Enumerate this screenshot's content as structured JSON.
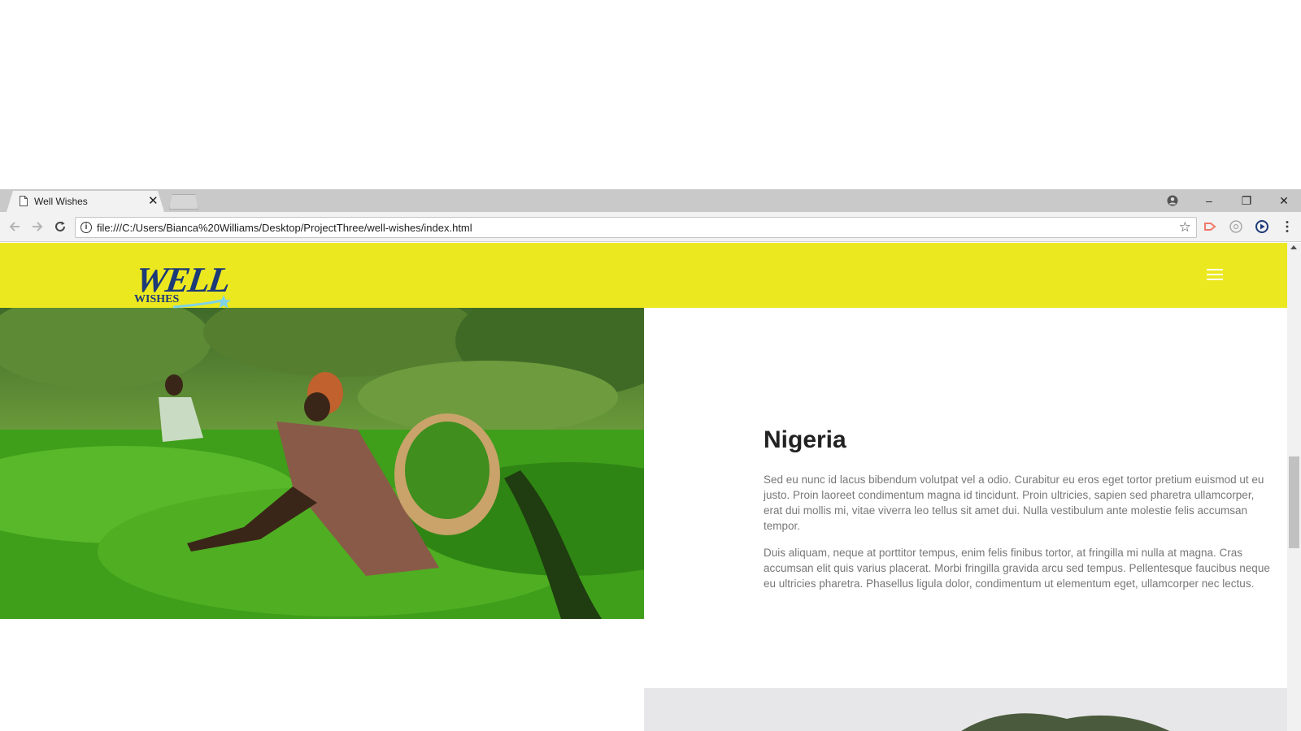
{
  "browser": {
    "tab_title": "Well Wishes",
    "url": "file:///C:/Users/Bianca%20Williams/Desktop/ProjectThree/well-wishes/index.html"
  },
  "site": {
    "logo_main": "WELL",
    "logo_sub": "WISHES"
  },
  "section": {
    "title": "Nigeria",
    "paragraphs": [
      "Sed eu nunc id lacus bibendum volutpat vel a odio. Curabitur eu eros eget tortor pretium euismod ut eu justo. Proin laoreet condimentum magna id tincidunt. Proin ultricies, sapien sed pharetra ullamcorper, erat dui mollis mi, vitae viverra leo tellus sit amet dui. Nulla vestibulum ante molestie felis accumsan tempor.",
      "Duis aliquam, neque at porttitor tempus, enim felis finibus tortor, at fringilla mi nulla at magna. Cras accumsan elit quis varius placerat. Morbi fringilla gravida arcu sed tempus. Pellentesque faucibus neque eu ultricies pharetra. Phasellus ligula dolor, condimentum ut elementum eget, ullamcorper nec lectus."
    ]
  },
  "colors": {
    "header_yellow": "#ece81f",
    "logo_navy": "#1c3a78",
    "logo_accent": "#7fd3e6"
  }
}
